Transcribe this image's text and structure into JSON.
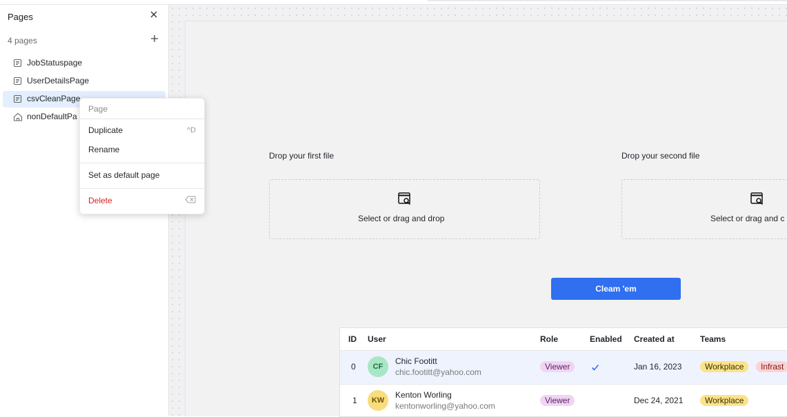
{
  "sidebar": {
    "title": "Pages",
    "page_count": "4 pages",
    "pages": [
      {
        "label": "JobStatuspage"
      },
      {
        "label": "UserDetailsPage"
      },
      {
        "label": "csvCleanPage"
      },
      {
        "label": "nonDefaultPa"
      }
    ]
  },
  "context_menu": {
    "header": "Page",
    "duplicate": "Duplicate",
    "duplicate_shortcut": "^D",
    "rename": "Rename",
    "set_default": "Set as default page",
    "delete": "Delete"
  },
  "canvas": {
    "drop1_label": "Drop your first file",
    "drop1_text": "Select or drag and drop",
    "drop2_label": "Drop your second file",
    "drop2_text": "Select or drag and c",
    "button_label": "Cleam 'em"
  },
  "table": {
    "headers": {
      "id": "ID",
      "user": "User",
      "role": "Role",
      "enabled": "Enabled",
      "created": "Created at",
      "teams": "Teams"
    },
    "rows": [
      {
        "id": "0",
        "initials": "CF",
        "name": "Chic Footitt",
        "email": "chic.footitt@yahoo.com",
        "role": "Viewer",
        "enabled": true,
        "created": "Jan 16, 2023",
        "team1": "Workplace",
        "team2": "Infrast"
      },
      {
        "id": "1",
        "initials": "KW",
        "name": "Kenton Worling",
        "email": "kentonworling@yahoo.com",
        "role": "Viewer",
        "enabled": false,
        "created": "Dec 24, 2021",
        "team1": "Workplace"
      }
    ]
  },
  "colors": {
    "accent": "#2f6ff0",
    "selected_row": "#eef3fe",
    "active_page": "#e3eefe",
    "danger": "#d0241f",
    "avatar_cf": "#a8e6c4",
    "avatar_kw": "#f8dc7e"
  },
  "icons": [
    "close-icon",
    "plus-icon",
    "page-icon",
    "home-icon",
    "backspace-icon",
    "file-search-icon",
    "check-icon"
  ]
}
